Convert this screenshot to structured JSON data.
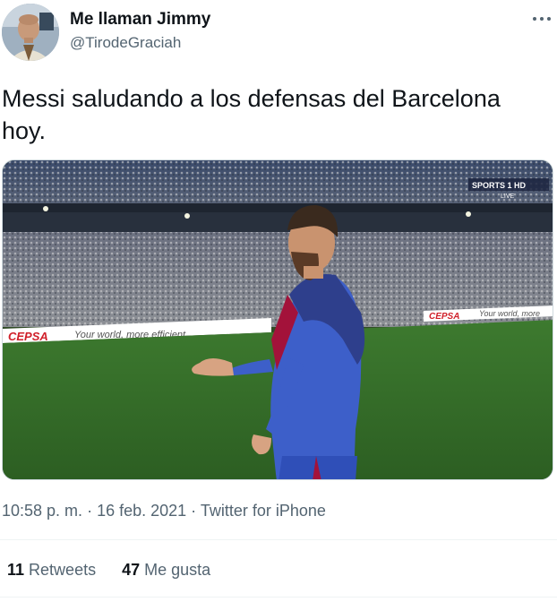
{
  "author": {
    "display_name": "Me llaman Jimmy",
    "handle": "@TirodeGraciah"
  },
  "more_icon": "more-horizontal-icon",
  "tweet": {
    "text": "Messi saludando a los defensas del Barcelona hoy."
  },
  "media": {
    "ad_board_left": "CEPSA",
    "ad_board_left_slogan": "Your world, more efficient",
    "ad_board_right": "CEPSA",
    "ad_board_right_slogan": "Your world, more",
    "broadcaster": "SPORTS 1 HD",
    "broadcaster_live": "LIVE"
  },
  "meta": {
    "time": "10:58 p. m.",
    "sep1": " · ",
    "date": "16 feb. 2021",
    "sep2": " · ",
    "source": "Twitter for iPhone"
  },
  "stats": {
    "retweets_count": "11",
    "retweets_label": "Retweets",
    "likes_count": "47",
    "likes_label": "Me gusta"
  }
}
